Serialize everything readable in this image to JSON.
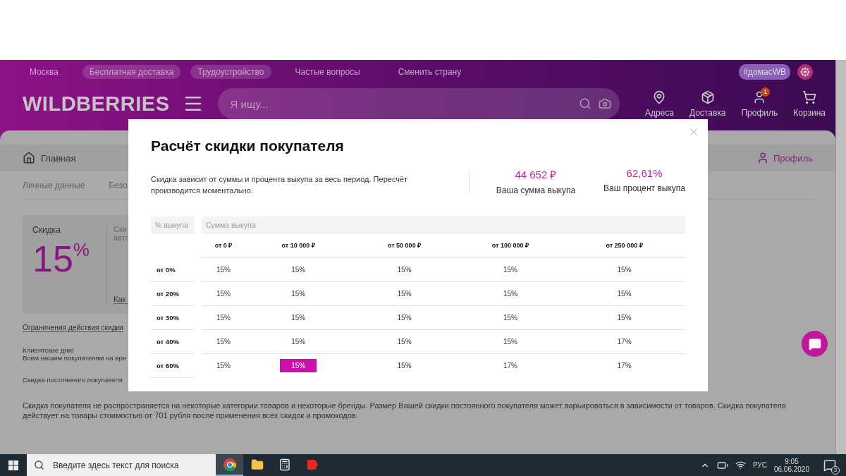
{
  "top_bar": {
    "links": [
      {
        "label": "Москва",
        "pill": false
      },
      {
        "label": "Бесплатная доставка",
        "pill": true
      },
      {
        "label": "Трудоустройство",
        "pill": true
      },
      {
        "label": "Частые вопросы",
        "pill": false
      },
      {
        "label": "Сменить страну",
        "pill": false
      }
    ],
    "hashtag": "#домасWB"
  },
  "header": {
    "logo": "WILDBERRIES",
    "search_placeholder": "Я ищу...",
    "nav": [
      {
        "label": "Адреса",
        "kind": "pin"
      },
      {
        "label": "Доставка",
        "kind": "box"
      },
      {
        "label": "Профиль",
        "kind": "user",
        "badge": "1"
      },
      {
        "label": "Корзина",
        "kind": "cart"
      }
    ]
  },
  "breadcrumb": {
    "home": "Главная",
    "profile": "Профиль"
  },
  "profile_tabs": [
    "Личные данные",
    "Безо"
  ],
  "discount_card": {
    "label": "Скидка",
    "value": "15",
    "unit": "%",
    "text_lines": [
      "Ски",
      "авто"
    ],
    "link": "Как"
  },
  "notes": [
    {
      "kind": "link",
      "lines": [
        "Ограничения действия скидки"
      ]
    },
    {
      "kind": "text",
      "lines": [
        "Клиентские дни!",
        "Всем нашим покупателям на вре"
      ]
    },
    {
      "kind": "text",
      "lines": [
        "Скидка постоянного покупателя"
      ]
    }
  ],
  "footer_note": "Скидка покупателя не распространяется на некоторые категории товаров и некоторые бренды. Размер Вашей скидки постоянного покупателя может варьироваться в зависимости от товаров. Скидка покупателя действует на товары стоимостью от 701 рубля после применения всех скидок и промокодов.",
  "modal": {
    "title": "Расчёт скидки покупателя",
    "description": "Скидка зависит от суммы и процента выкупа за весь период. Пересчёт производится моментально.",
    "stats": [
      {
        "value": "44 652 ₽",
        "label": "Ваша сумма выкупа"
      },
      {
        "value": "62,61%",
        "label": "Ваш процент выкупа"
      }
    ],
    "table": {
      "row_header": "% выкупа",
      "column_group": "Сумма выкупа",
      "columns": [
        "от 0 ₽",
        "от 10 000 ₽",
        "от 50 000 ₽",
        "от 100 000 ₽",
        "от 250 000 ₽"
      ],
      "rows": [
        {
          "label": "от 0%",
          "cells": [
            {
              "text": "15%",
              "selected": false
            },
            {
              "text": "15%",
              "selected": false
            },
            {
              "text": "15%",
              "selected": false
            },
            {
              "text": "15%",
              "selected": false
            },
            {
              "text": "15%",
              "selected": false
            }
          ]
        },
        {
          "label": "от 20%",
          "cells": [
            {
              "text": "15%",
              "selected": false
            },
            {
              "text": "15%",
              "selected": false
            },
            {
              "text": "15%",
              "selected": false
            },
            {
              "text": "15%",
              "selected": false
            },
            {
              "text": "15%",
              "selected": false
            }
          ]
        },
        {
          "label": "от 30%",
          "cells": [
            {
              "text": "15%",
              "selected": false
            },
            {
              "text": "15%",
              "selected": false
            },
            {
              "text": "15%",
              "selected": false
            },
            {
              "text": "15%",
              "selected": false
            },
            {
              "text": "15%",
              "selected": false
            }
          ]
        },
        {
          "label": "от 40%",
          "cells": [
            {
              "text": "15%",
              "selected": false
            },
            {
              "text": "15%",
              "selected": false
            },
            {
              "text": "15%",
              "selected": false
            },
            {
              "text": "15%",
              "selected": false
            },
            {
              "text": "17%",
              "selected": false
            }
          ]
        },
        {
          "label": "от 60%",
          "cells": [
            {
              "text": "15%",
              "selected": false
            },
            {
              "text": "15%",
              "selected": true
            },
            {
              "text": "15%",
              "selected": false
            },
            {
              "text": "17%",
              "selected": false
            },
            {
              "text": "17%",
              "selected": false
            }
          ]
        }
      ]
    }
  },
  "taskbar": {
    "search_placeholder": "Введите здесь текст для поиска",
    "apps": [
      {
        "kind": "chrome",
        "selected": true
      },
      {
        "kind": "folder",
        "selected": false
      },
      {
        "kind": "calculator",
        "selected": false
      },
      {
        "kind": "yandex",
        "selected": false
      }
    ],
    "language": "РУС",
    "time": "9:05",
    "date": "06.06.2020",
    "notifications": "3"
  }
}
